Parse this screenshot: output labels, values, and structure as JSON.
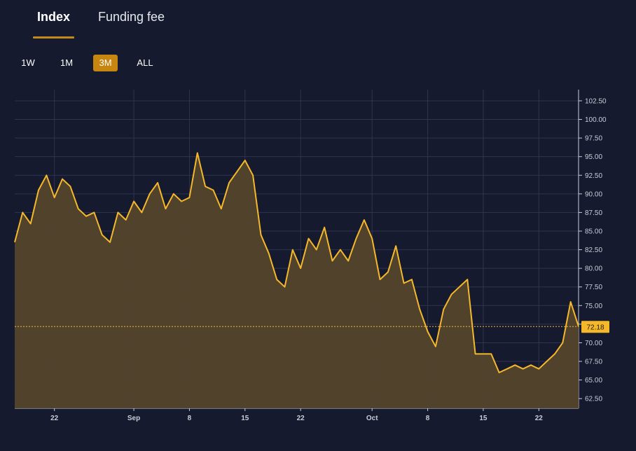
{
  "tabs": {
    "index_label": "Index",
    "funding_label": "Funding fee",
    "active": "Index"
  },
  "ranges": {
    "items": [
      "1W",
      "1M",
      "3M",
      "ALL"
    ],
    "active": "3M"
  },
  "colors": {
    "background": "#161a2e",
    "line": "#f5b82a",
    "fill": "#54452c",
    "grid": "#2f3450",
    "accent": "#c7860f"
  },
  "chart_data": {
    "type": "area",
    "x_start": "Aug 17",
    "x_end": "Oct 27",
    "x_ticks": [
      "22",
      "Sep",
      "8",
      "15",
      "22",
      "Oct",
      "8",
      "15",
      "22"
    ],
    "y_ticks": [
      "102.50",
      "100.00",
      "97.50",
      "95.00",
      "92.50",
      "90.00",
      "87.50",
      "85.00",
      "82.50",
      "80.00",
      "77.50",
      "75.00",
      "72.50",
      "70.00",
      "67.50",
      "65.00",
      "62.50"
    ],
    "ylim": [
      61.2,
      104
    ],
    "last_value": 72.18,
    "last_label": "72.18",
    "points": [
      [
        "Aug 17",
        83.5
      ],
      [
        "Aug 18",
        87.5
      ],
      [
        "Aug 19",
        86.0
      ],
      [
        "Aug 20",
        90.5
      ],
      [
        "Aug 21",
        92.5
      ],
      [
        "Aug 22",
        89.5
      ],
      [
        "Aug 23",
        92.0
      ],
      [
        "Aug 24",
        91.0
      ],
      [
        "Aug 25",
        88.0
      ],
      [
        "Aug 26",
        87.0
      ],
      [
        "Aug 27",
        87.5
      ],
      [
        "Aug 28",
        84.5
      ],
      [
        "Aug 29",
        83.5
      ],
      [
        "Aug 30",
        87.5
      ],
      [
        "Aug 31",
        86.5
      ],
      [
        "Sep 1",
        89.0
      ],
      [
        "Sep 2",
        87.5
      ],
      [
        "Sep 3",
        90.0
      ],
      [
        "Sep 4",
        91.5
      ],
      [
        "Sep 5",
        88.0
      ],
      [
        "Sep 6",
        90.0
      ],
      [
        "Sep 7",
        89.0
      ],
      [
        "Sep 8",
        89.5
      ],
      [
        "Sep 9",
        95.5
      ],
      [
        "Sep 10",
        91.0
      ],
      [
        "Sep 11",
        90.5
      ],
      [
        "Sep 12",
        88.0
      ],
      [
        "Sep 13",
        91.5
      ],
      [
        "Sep 14",
        93.0
      ],
      [
        "Sep 15",
        94.5
      ],
      [
        "Sep 16",
        92.5
      ],
      [
        "Sep 17",
        84.5
      ],
      [
        "Sep 18",
        82.0
      ],
      [
        "Sep 19",
        78.5
      ],
      [
        "Sep 20",
        77.5
      ],
      [
        "Sep 21",
        82.5
      ],
      [
        "Sep 22",
        80.0
      ],
      [
        "Sep 23",
        84.0
      ],
      [
        "Sep 24",
        82.5
      ],
      [
        "Sep 25",
        85.5
      ],
      [
        "Sep 26",
        81.0
      ],
      [
        "Sep 27",
        82.5
      ],
      [
        "Sep 28",
        81.0
      ],
      [
        "Sep 29",
        84.0
      ],
      [
        "Sep 30",
        86.5
      ],
      [
        "Oct 1",
        84.0
      ],
      [
        "Oct 2",
        78.5
      ],
      [
        "Oct 3",
        79.5
      ],
      [
        "Oct 4",
        83.0
      ],
      [
        "Oct 5",
        78.0
      ],
      [
        "Oct 6",
        78.5
      ],
      [
        "Oct 7",
        74.5
      ],
      [
        "Oct 8",
        71.5
      ],
      [
        "Oct 9",
        69.5
      ],
      [
        "Oct 10",
        74.5
      ],
      [
        "Oct 11",
        76.5
      ],
      [
        "Oct 12",
        77.5
      ],
      [
        "Oct 13",
        78.5
      ],
      [
        "Oct 14",
        68.5
      ],
      [
        "Oct 15",
        68.5
      ],
      [
        "Oct 16",
        68.5
      ],
      [
        "Oct 17",
        66.0
      ],
      [
        "Oct 18",
        66.5
      ],
      [
        "Oct 19",
        67.0
      ],
      [
        "Oct 20",
        66.5
      ],
      [
        "Oct 21",
        67.0
      ],
      [
        "Oct 22",
        66.5
      ],
      [
        "Oct 23",
        67.5
      ],
      [
        "Oct 24",
        68.5
      ],
      [
        "Oct 25",
        70.0
      ],
      [
        "Oct 26",
        75.5
      ],
      [
        "Oct 27",
        72.18
      ]
    ]
  }
}
